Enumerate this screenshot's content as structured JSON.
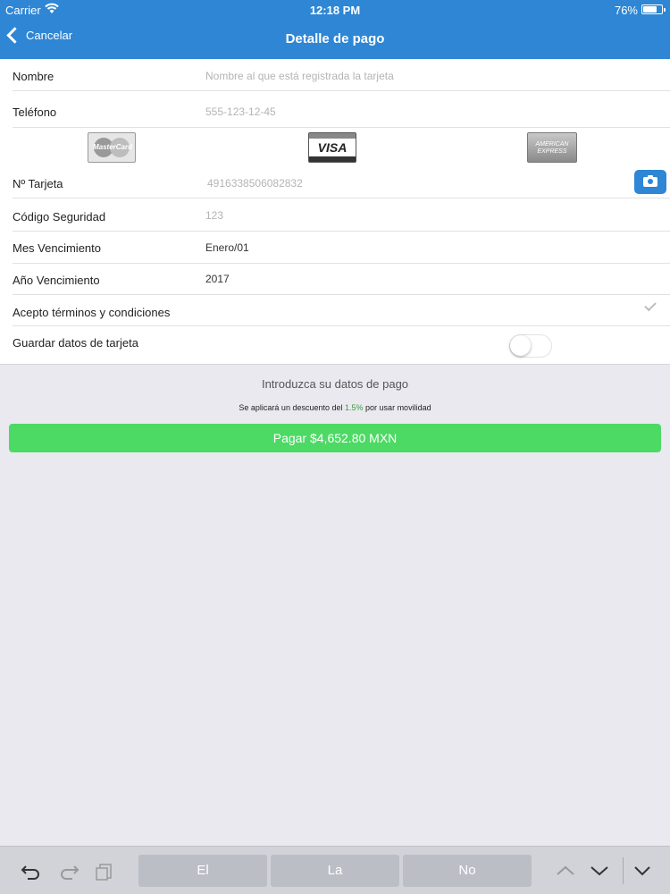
{
  "status_bar": {
    "carrier": "Carrier",
    "time": "12:18 PM",
    "battery_pct": "76%",
    "battery_level": 0.76
  },
  "nav": {
    "back_label": "Cancelar",
    "title": "Detalle de pago"
  },
  "form": {
    "nombre": {
      "label": "Nombre",
      "placeholder": "Nombre al que está registrada la tarjeta"
    },
    "telefono": {
      "label": "Teléfono",
      "placeholder": "555-123-12-45"
    },
    "card_brands": [
      "MasterCard",
      "VISA",
      "AMERICAN EXPRESS"
    ],
    "tarjeta": {
      "label": "Nº Tarjeta",
      "placeholder": "4916338506082832"
    },
    "codigo": {
      "label": "Código Seguridad",
      "placeholder": "123"
    },
    "mes": {
      "label": "Mes Vencimiento",
      "value": "Enero/01"
    },
    "anio": {
      "label": "Año Vencimiento",
      "value": "2017"
    },
    "terminos": {
      "label": "Acepto términos y condiciones",
      "checked": true
    },
    "guardar": {
      "label": "Guardar datos de tarjeta",
      "on": false
    }
  },
  "info_text": "Introduzca su datos de pago",
  "discount": {
    "prefix": "Se aplicará un descuento del",
    "pct": "1.5%",
    "suffix": "por usar movilidad"
  },
  "pay_button": "Pagar $4,652.80 MXN",
  "keyboard": {
    "suggestions": [
      "El",
      "La",
      "No"
    ],
    "icons": [
      "undo-icon",
      "redo-icon",
      "paste-icon",
      "chevron-up-icon",
      "chevron-down-icon",
      "dismiss-keyboard-icon"
    ]
  },
  "colors": {
    "accent": "#2e86d4",
    "pay": "#4cd964",
    "discount_pct": "#3a9c3a"
  }
}
